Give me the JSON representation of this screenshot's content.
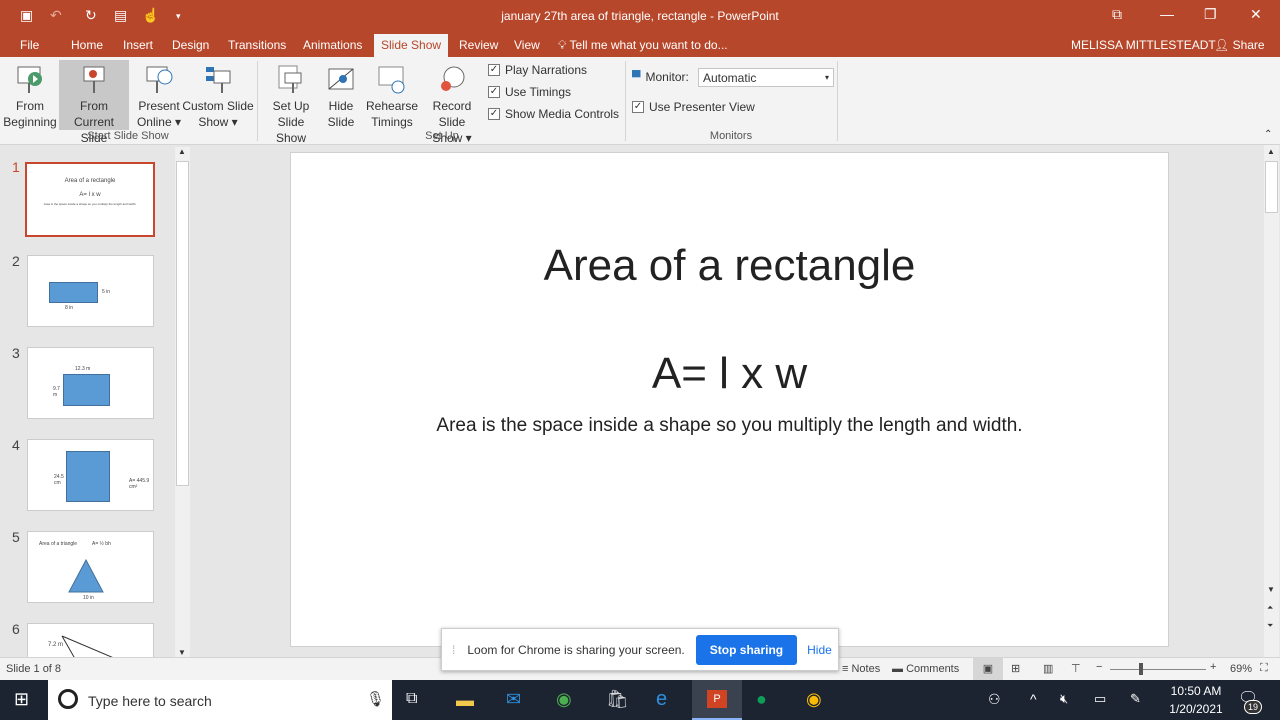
{
  "window": {
    "title": "january 27th  area of triangle, rectangle - PowerPoint",
    "accent": "#b7472a"
  },
  "tabs": [
    "File",
    "Home",
    "Insert",
    "Design",
    "Transitions",
    "Animations",
    "Slide Show",
    "Review",
    "View"
  ],
  "tell_me": "Tell me what you want to do...",
  "user": "MELISSA MITTLESTEADT",
  "share": "Share",
  "ribbon": {
    "buttons": [
      {
        "l1": "From",
        "l2": "Beginning"
      },
      {
        "l1": "From",
        "l2": "Current Slide"
      },
      {
        "l1": "Present",
        "l2": "Online ▾"
      },
      {
        "l1": "Custom Slide",
        "l2": "Show ▾"
      },
      {
        "l1": "Set Up",
        "l2": "Slide Show"
      },
      {
        "l1": "Hide",
        "l2": "Slide"
      },
      {
        "l1": "Rehearse",
        "l2": "Timings"
      },
      {
        "l1": "Record Slide",
        "l2": "Show ▾"
      }
    ],
    "checks": [
      "Play Narrations",
      "Use Timings",
      "Show Media Controls",
      "Use Presenter View"
    ],
    "monitor_label": "Monitor:",
    "monitor_value": "Automatic",
    "groups": [
      "Start Slide Show",
      "Set Up",
      "Monitors"
    ]
  },
  "thumbnails": [
    {
      "n": "1",
      "title": "Area of a rectangle",
      "formula": "A= l x w",
      "text": "Area is the space inside a shape so you multiply the length and width."
    },
    {
      "n": "2",
      "a": "5 in",
      "b": "8 in"
    },
    {
      "n": "3",
      "a": "12.3 m",
      "b": "9.7 m"
    },
    {
      "n": "4",
      "a": "24.5 cm",
      "b": "A= 445.9 cm²"
    },
    {
      "n": "5",
      "title": "Area of a triangle",
      "formula": "A= ½ bh",
      "b": "10 in"
    },
    {
      "n": "6",
      "a": "7.2 m"
    }
  ],
  "slide": {
    "title": "Area of a rectangle",
    "formula": "A= l x w",
    "body": "Area is the space inside a shape so you multiply the length and width."
  },
  "status": {
    "slide": "Slide 1 of 8",
    "notes": "Notes",
    "comments": "Comments",
    "zoom": "69%"
  },
  "loom": {
    "message": "Loom for Chrome is sharing your screen.",
    "stop": "Stop sharing",
    "hide": "Hide"
  },
  "taskbar": {
    "search": "Type here to search",
    "time": "10:50 AM",
    "date": "1/20/2021",
    "notifications": "19"
  }
}
